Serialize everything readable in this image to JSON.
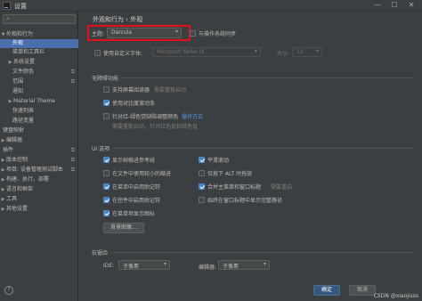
{
  "window": {
    "title": "设置",
    "minimize": "—",
    "maximize": "☐",
    "close": "✕"
  },
  "sidebar": {
    "search_placeholder": "",
    "items": [
      {
        "label": "外观和行为",
        "arrow": "▼",
        "badge": ""
      },
      {
        "label": "外观",
        "arrow": "",
        "badge": ""
      },
      {
        "label": "菜单和工具栏",
        "arrow": "",
        "badge": ""
      },
      {
        "label": "系统设置",
        "arrow": "▶",
        "badge": ""
      },
      {
        "label": "文件颜色",
        "arrow": "",
        "badge": "⧉"
      },
      {
        "label": "范围",
        "arrow": "",
        "badge": "⧉"
      },
      {
        "label": "通知",
        "arrow": "",
        "badge": ""
      },
      {
        "label": "Material Theme",
        "arrow": "▶",
        "badge": ""
      },
      {
        "label": "快速列表",
        "arrow": "",
        "badge": ""
      },
      {
        "label": "路径变量",
        "arrow": "",
        "badge": ""
      },
      {
        "label": "键盘映射",
        "arrow": "",
        "badge": ""
      },
      {
        "label": "编辑器",
        "arrow": "▶",
        "badge": ""
      },
      {
        "label": "插件",
        "arrow": "",
        "badge": "⧉"
      },
      {
        "label": "版本控制",
        "arrow": "▶",
        "badge": "⧉"
      },
      {
        "label": "项目: 设备管理测试脚本",
        "arrow": "▶",
        "badge": "⧉"
      },
      {
        "label": "构建、执行、部署",
        "arrow": "▶",
        "badge": ""
      },
      {
        "label": "语言和框架",
        "arrow": "▶",
        "badge": ""
      },
      {
        "label": "工具",
        "arrow": "▶",
        "badge": ""
      },
      {
        "label": "其他设置",
        "arrow": "▶",
        "badge": ""
      }
    ]
  },
  "breadcrumb": {
    "parent": "外观和行为",
    "sep": "›",
    "current": "外观"
  },
  "theme": {
    "label": "主题:",
    "value": "Darcula",
    "arrow": "▾",
    "sync_label": "与操作系统同步"
  },
  "custom_font": {
    "label": "使用自定义字体:",
    "value": "Microsoft YaHei UI",
    "size_label": "大小:",
    "size_value": "12",
    "arrow": "▾"
  },
  "accessibility": {
    "title": "无障碍功能",
    "screen_reader_label": "支持屏幕阅读器",
    "screen_reader_hint": "需要重新启动",
    "contrast_scrollbars_label": "使用对比度滚动条",
    "color_blind_label": "针对红-绿色觉缺陷调整颜色",
    "color_blind_link": "操作方式",
    "color_blind_hint": "需要重新启动，针对红色盲和绿色盲"
  },
  "ui_options": {
    "title": "UI 选项",
    "left": [
      {
        "label": "显示树缩进参考线",
        "checked": true,
        "hint": ""
      },
      {
        "label": "在文件中使用较小的缩进",
        "checked": false,
        "hint": ""
      },
      {
        "label": "在菜单中启用助记符",
        "checked": true,
        "hint": ""
      },
      {
        "label": "在控件中启用助记符",
        "checked": true,
        "hint": ""
      },
      {
        "label": "在菜单项显示图标",
        "checked": true,
        "hint": ""
      }
    ],
    "right": [
      {
        "label": "平滑滚动",
        "checked": true,
        "hint": ""
      },
      {
        "label": "仅按下 ALT 时拖放",
        "checked": false,
        "hint": ""
      },
      {
        "label": "合并主菜单和窗口标题",
        "checked": true,
        "hint": "需要重启"
      },
      {
        "label": "始终在窗口标题中显示完整路径",
        "checked": false,
        "hint": ""
      }
    ],
    "background_image_button": "背景图像..."
  },
  "antialiasing": {
    "title": "抗锯齿",
    "ide_label": "IDE:",
    "ide_value": "子像素",
    "editor_label": "编辑器:",
    "editor_value": "子像素",
    "arrow": "▾"
  },
  "footer": {
    "ok": "确定",
    "cancel": "取消",
    "help": "?",
    "watermark": "CSDN @xiaojisss"
  }
}
